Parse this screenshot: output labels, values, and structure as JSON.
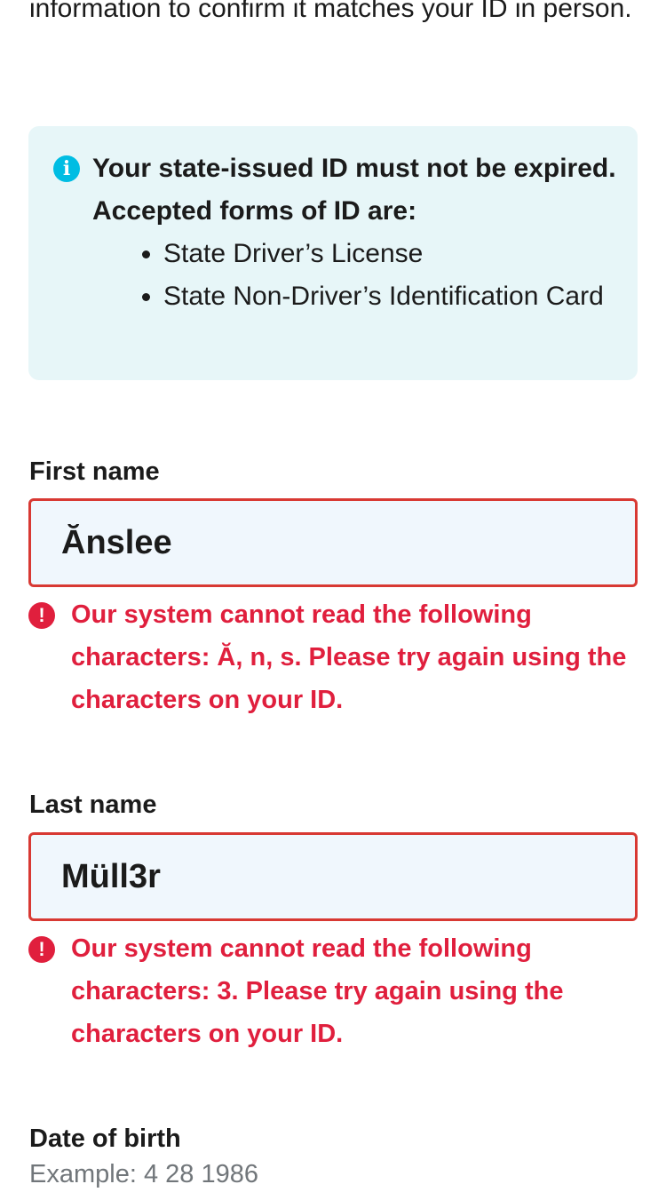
{
  "intro": {
    "text": "information to confirm it matches your ID in person."
  },
  "alert": {
    "icon": "info-icon",
    "heading": "Your state-issued ID must not be expired. Accepted forms of ID are:",
    "items": [
      "State Driver’s License",
      "State Non-Driver’s Identification Card"
    ],
    "background": "#e7f6f8",
    "icon_color": "#00bde3"
  },
  "first_name": {
    "label": "First name",
    "value": "Ănslee",
    "error": "Our system cannot read the following characters: Ă, n, s. Please try again using the characters on your ID."
  },
  "last_name": {
    "label": "Last name",
    "value": "Müll3r",
    "error": "Our system cannot read the following characters: 3. Please try again using the characters on your ID."
  },
  "date_of_birth": {
    "label": "Date of birth",
    "hint": "Example: 4 28 1986"
  },
  "colors": {
    "error": "#e01f3d",
    "input_background": "#f0f7fd",
    "text": "#1b1b1b",
    "hint": "#71767a"
  }
}
